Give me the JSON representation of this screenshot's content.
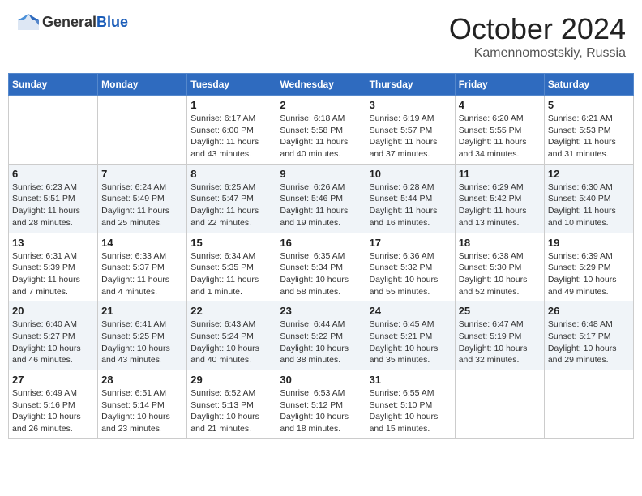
{
  "header": {
    "logo": {
      "general": "General",
      "blue": "Blue"
    },
    "month": "October 2024",
    "location": "Kamennomostskiy, Russia"
  },
  "weekdays": [
    "Sunday",
    "Monday",
    "Tuesday",
    "Wednesday",
    "Thursday",
    "Friday",
    "Saturday"
  ],
  "weeks": [
    [
      {
        "day": "",
        "info": ""
      },
      {
        "day": "",
        "info": ""
      },
      {
        "day": "1",
        "info": "Sunrise: 6:17 AM\nSunset: 6:00 PM\nDaylight: 11 hours and 43 minutes."
      },
      {
        "day": "2",
        "info": "Sunrise: 6:18 AM\nSunset: 5:58 PM\nDaylight: 11 hours and 40 minutes."
      },
      {
        "day": "3",
        "info": "Sunrise: 6:19 AM\nSunset: 5:57 PM\nDaylight: 11 hours and 37 minutes."
      },
      {
        "day": "4",
        "info": "Sunrise: 6:20 AM\nSunset: 5:55 PM\nDaylight: 11 hours and 34 minutes."
      },
      {
        "day": "5",
        "info": "Sunrise: 6:21 AM\nSunset: 5:53 PM\nDaylight: 11 hours and 31 minutes."
      }
    ],
    [
      {
        "day": "6",
        "info": "Sunrise: 6:23 AM\nSunset: 5:51 PM\nDaylight: 11 hours and 28 minutes."
      },
      {
        "day": "7",
        "info": "Sunrise: 6:24 AM\nSunset: 5:49 PM\nDaylight: 11 hours and 25 minutes."
      },
      {
        "day": "8",
        "info": "Sunrise: 6:25 AM\nSunset: 5:47 PM\nDaylight: 11 hours and 22 minutes."
      },
      {
        "day": "9",
        "info": "Sunrise: 6:26 AM\nSunset: 5:46 PM\nDaylight: 11 hours and 19 minutes."
      },
      {
        "day": "10",
        "info": "Sunrise: 6:28 AM\nSunset: 5:44 PM\nDaylight: 11 hours and 16 minutes."
      },
      {
        "day": "11",
        "info": "Sunrise: 6:29 AM\nSunset: 5:42 PM\nDaylight: 11 hours and 13 minutes."
      },
      {
        "day": "12",
        "info": "Sunrise: 6:30 AM\nSunset: 5:40 PM\nDaylight: 11 hours and 10 minutes."
      }
    ],
    [
      {
        "day": "13",
        "info": "Sunrise: 6:31 AM\nSunset: 5:39 PM\nDaylight: 11 hours and 7 minutes."
      },
      {
        "day": "14",
        "info": "Sunrise: 6:33 AM\nSunset: 5:37 PM\nDaylight: 11 hours and 4 minutes."
      },
      {
        "day": "15",
        "info": "Sunrise: 6:34 AM\nSunset: 5:35 PM\nDaylight: 11 hours and 1 minute."
      },
      {
        "day": "16",
        "info": "Sunrise: 6:35 AM\nSunset: 5:34 PM\nDaylight: 10 hours and 58 minutes."
      },
      {
        "day": "17",
        "info": "Sunrise: 6:36 AM\nSunset: 5:32 PM\nDaylight: 10 hours and 55 minutes."
      },
      {
        "day": "18",
        "info": "Sunrise: 6:38 AM\nSunset: 5:30 PM\nDaylight: 10 hours and 52 minutes."
      },
      {
        "day": "19",
        "info": "Sunrise: 6:39 AM\nSunset: 5:29 PM\nDaylight: 10 hours and 49 minutes."
      }
    ],
    [
      {
        "day": "20",
        "info": "Sunrise: 6:40 AM\nSunset: 5:27 PM\nDaylight: 10 hours and 46 minutes."
      },
      {
        "day": "21",
        "info": "Sunrise: 6:41 AM\nSunset: 5:25 PM\nDaylight: 10 hours and 43 minutes."
      },
      {
        "day": "22",
        "info": "Sunrise: 6:43 AM\nSunset: 5:24 PM\nDaylight: 10 hours and 40 minutes."
      },
      {
        "day": "23",
        "info": "Sunrise: 6:44 AM\nSunset: 5:22 PM\nDaylight: 10 hours and 38 minutes."
      },
      {
        "day": "24",
        "info": "Sunrise: 6:45 AM\nSunset: 5:21 PM\nDaylight: 10 hours and 35 minutes."
      },
      {
        "day": "25",
        "info": "Sunrise: 6:47 AM\nSunset: 5:19 PM\nDaylight: 10 hours and 32 minutes."
      },
      {
        "day": "26",
        "info": "Sunrise: 6:48 AM\nSunset: 5:17 PM\nDaylight: 10 hours and 29 minutes."
      }
    ],
    [
      {
        "day": "27",
        "info": "Sunrise: 6:49 AM\nSunset: 5:16 PM\nDaylight: 10 hours and 26 minutes."
      },
      {
        "day": "28",
        "info": "Sunrise: 6:51 AM\nSunset: 5:14 PM\nDaylight: 10 hours and 23 minutes."
      },
      {
        "day": "29",
        "info": "Sunrise: 6:52 AM\nSunset: 5:13 PM\nDaylight: 10 hours and 21 minutes."
      },
      {
        "day": "30",
        "info": "Sunrise: 6:53 AM\nSunset: 5:12 PM\nDaylight: 10 hours and 18 minutes."
      },
      {
        "day": "31",
        "info": "Sunrise: 6:55 AM\nSunset: 5:10 PM\nDaylight: 10 hours and 15 minutes."
      },
      {
        "day": "",
        "info": ""
      },
      {
        "day": "",
        "info": ""
      }
    ]
  ]
}
